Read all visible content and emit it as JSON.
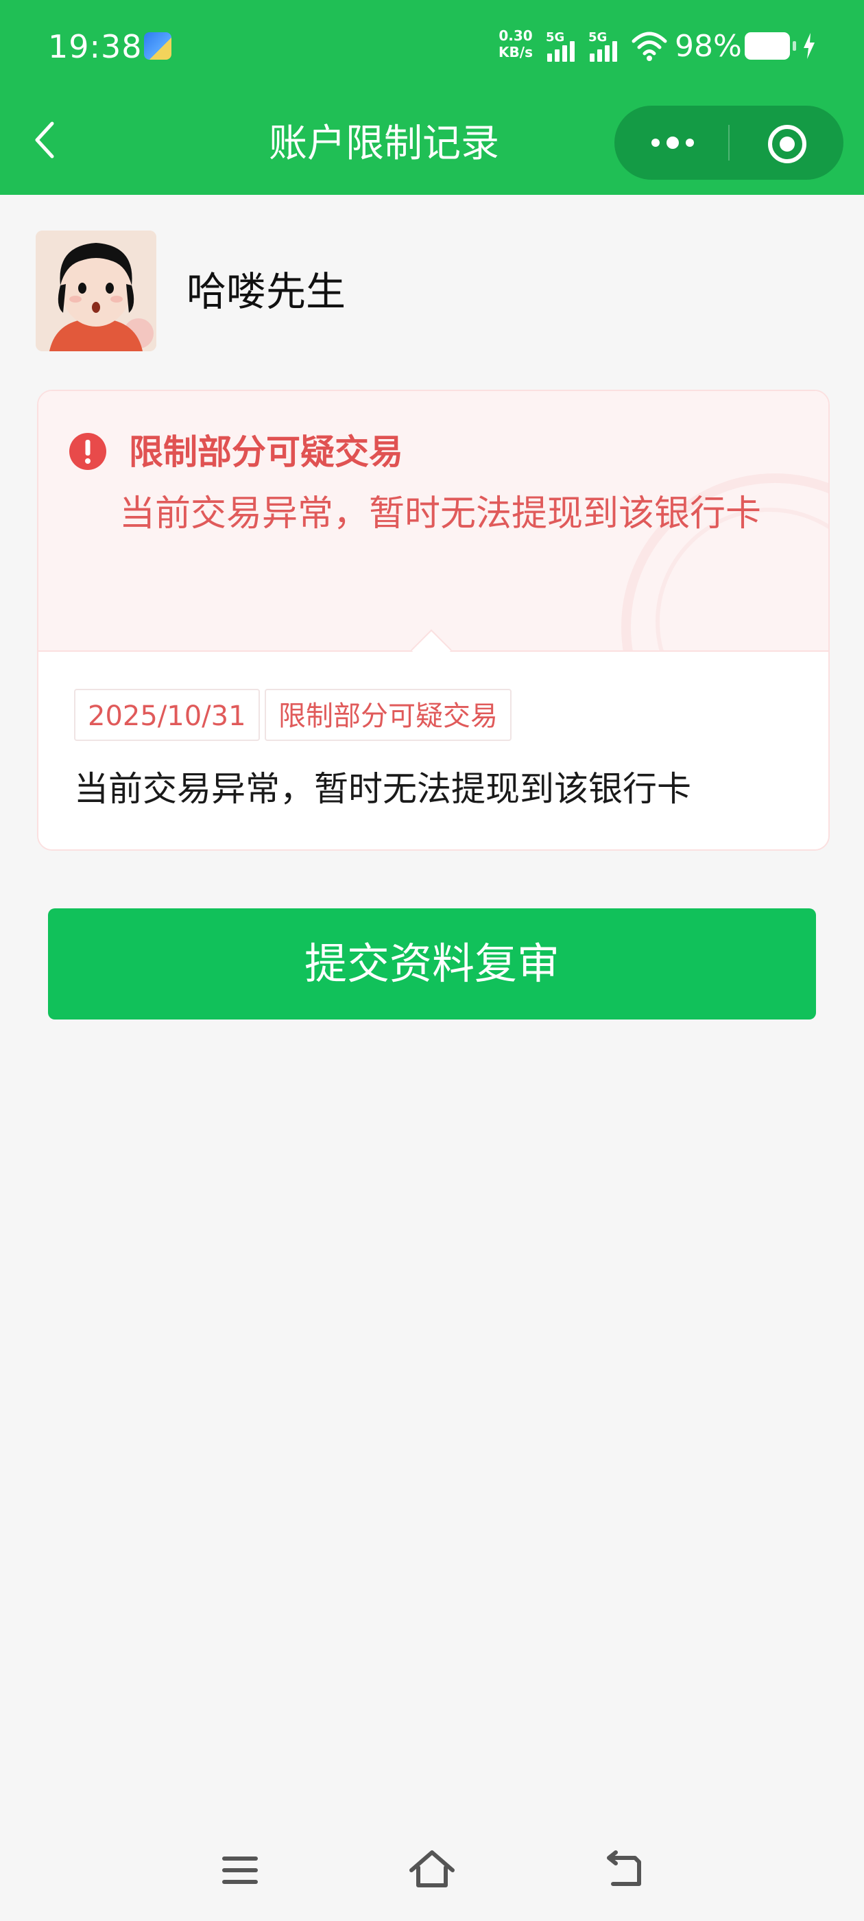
{
  "status_bar": {
    "time": "19:38",
    "network_speed_value": "0.30",
    "network_speed_unit": "KB/s",
    "signal_1_label": "5G",
    "signal_2_label": "5G",
    "battery": "98%"
  },
  "nav_bar": {
    "title": "账户限制记录",
    "back_icon": "chevron-left-icon",
    "more_icon": "more-dots-icon",
    "close_icon": "target-circle-icon"
  },
  "user": {
    "name": "哈喽先生",
    "avatar_icon": "cartoon-avatar"
  },
  "alert": {
    "icon": "exclamation-circle-icon",
    "title": "限制部分可疑交易",
    "description": "当前交易异常，暂时无法提现到该银行卡"
  },
  "record": {
    "date": "2025/10/31",
    "type": "限制部分可疑交易",
    "detail": "当前交易异常，暂时无法提现到该银行卡"
  },
  "actions": {
    "submit_label": "提交资料复审"
  },
  "system_nav": {
    "menu_icon": "menu-icon",
    "home_icon": "home-icon",
    "back_icon": "back-arrow-icon"
  },
  "colors": {
    "header_green": "#20bf55",
    "button_green": "#11c15a",
    "alert_red": "#e05252",
    "background": "#f6f6f6"
  }
}
